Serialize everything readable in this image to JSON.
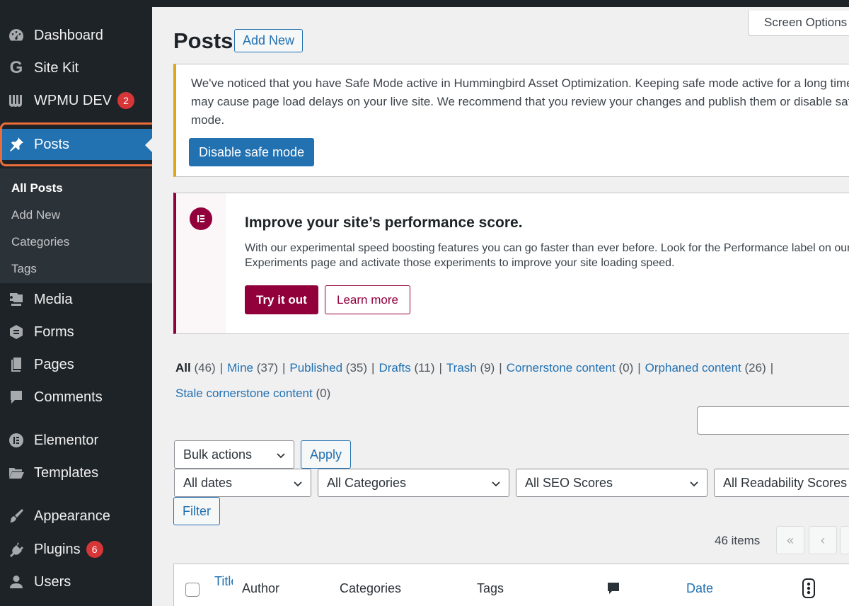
{
  "sidebar": {
    "items": [
      {
        "label": "Dashboard",
        "icon": "dashboard-icon"
      },
      {
        "label": "Site Kit",
        "icon": "google-g-icon"
      },
      {
        "label": "WPMU DEV",
        "icon": "wpmudev-icon",
        "badge": "2"
      },
      {
        "label": "Posts",
        "icon": "pin-icon",
        "active": true
      },
      {
        "label": "Media",
        "icon": "media-icon"
      },
      {
        "label": "Forms",
        "icon": "forms-icon"
      },
      {
        "label": "Pages",
        "icon": "pages-icon"
      },
      {
        "label": "Comments",
        "icon": "comment-icon"
      },
      {
        "label": "Elementor",
        "icon": "elementor-icon"
      },
      {
        "label": "Templates",
        "icon": "folder-icon"
      },
      {
        "label": "Appearance",
        "icon": "brush-icon"
      },
      {
        "label": "Plugins",
        "icon": "plug-icon",
        "badge": "6"
      },
      {
        "label": "Users",
        "icon": "user-icon"
      }
    ],
    "submenu": [
      "All Posts",
      "Add New",
      "Categories",
      "Tags"
    ]
  },
  "header": {
    "screen_options": "Screen Options",
    "title": "Posts",
    "add_new": "Add New"
  },
  "notice_safe_mode": {
    "text": "We've noticed that you have Safe Mode active in Hummingbird Asset Optimization. Keeping safe mode active for a long time may cause page load delays on your live site. We recommend that you review your changes and publish them or disable safe mode.",
    "button": "Disable safe mode"
  },
  "notice_elementor": {
    "title": "Improve your site’s performance score.",
    "text": "With our experimental speed boosting features you can go faster than ever before. Look for the Performance label on our Experiments page and activate those experiments to improve your site loading speed.",
    "try": "Try it out",
    "learn": "Learn more"
  },
  "views": [
    {
      "label": "All",
      "count": "(46)",
      "current": true
    },
    {
      "label": "Mine",
      "count": "(37)"
    },
    {
      "label": "Published",
      "count": "(35)"
    },
    {
      "label": "Drafts",
      "count": "(11)"
    },
    {
      "label": "Trash",
      "count": "(9)"
    },
    {
      "label": "Cornerstone content",
      "count": "(0)"
    },
    {
      "label": "Orphaned content",
      "count": "(26)"
    }
  ],
  "views_row2": {
    "label": "Stale cornerstone content",
    "count": "(0)"
  },
  "filters": {
    "bulk_actions": "Bulk actions",
    "apply": "Apply",
    "dates": "All dates",
    "categories": "All Categories",
    "seo": "All SEO Scores",
    "readability": "All Readability Scores",
    "filter": "Filter"
  },
  "pagination": {
    "items": "46 items",
    "first": "«",
    "prev": "‹"
  },
  "table": {
    "title": "Title",
    "author": "Author",
    "categories": "Categories",
    "tags": "Tags",
    "date": "Date"
  },
  "colors": {
    "sidebar_bg": "#1d2327",
    "accent": "#2271b1",
    "elementor": "#92003b",
    "warning": "#dba617",
    "badge": "#d63638",
    "highlight_outline": "#ec6d3a"
  }
}
